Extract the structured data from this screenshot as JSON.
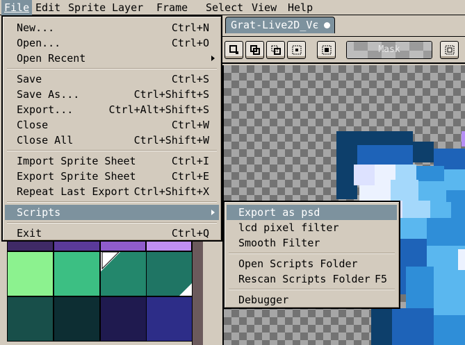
{
  "menubar": {
    "file": "File",
    "edit": "Edit",
    "sprite": "Sprite",
    "layer": "Layer",
    "frame": "Frame",
    "select": "Select",
    "view": "View",
    "help": "Help"
  },
  "tab": {
    "title": "Grat-Live2D_Vє"
  },
  "toolbar": {
    "mask_label": "Mask"
  },
  "file_menu": {
    "items": [
      {
        "label": "New...",
        "shortcut": "Ctrl+N"
      },
      {
        "label": "Open...",
        "shortcut": "Ctrl+O"
      },
      {
        "label": "Open Recent",
        "shortcut": ""
      },
      {
        "label": "Save",
        "shortcut": "Ctrl+S"
      },
      {
        "label": "Save As...",
        "shortcut": "Ctrl+Shift+S"
      },
      {
        "label": "Export...",
        "shortcut": "Ctrl+Alt+Shift+S"
      },
      {
        "label": "Close",
        "shortcut": "Ctrl+W"
      },
      {
        "label": "Close All",
        "shortcut": "Ctrl+Shift+W"
      },
      {
        "label": "Import Sprite Sheet",
        "shortcut": "Ctrl+I"
      },
      {
        "label": "Export Sprite Sheet",
        "shortcut": "Ctrl+E"
      },
      {
        "label": "Repeat Last Export",
        "shortcut": "Ctrl+Shift+X"
      },
      {
        "label": "Scripts",
        "shortcut": ""
      },
      {
        "label": "Exit",
        "shortcut": "Ctrl+Q"
      }
    ]
  },
  "scripts_menu": {
    "items": [
      {
        "label": "Export as psd",
        "shortcut": ""
      },
      {
        "label": "lcd pixel filter",
        "shortcut": ""
      },
      {
        "label": "Smooth Filter",
        "shortcut": ""
      },
      {
        "label": "Open Scripts Folder",
        "shortcut": ""
      },
      {
        "label": "Rescan Scripts Folder",
        "shortcut": "F5"
      },
      {
        "label": "Debugger",
        "shortcut": ""
      }
    ]
  },
  "colors": {
    "ui_bg": "#d3cbbe",
    "highlight": "#7d929e",
    "accent_tab": "#7d929e"
  },
  "palette": {
    "swatches": [
      "#8cf28f",
      "#3cbf83",
      "#23876c",
      "#1f7564",
      "#184f4a",
      "#0d2e33",
      "#1f1a4f",
      "#2d2d88"
    ],
    "top_strip": [
      "#3f2a66",
      "#5a3a99",
      "#8f5ccc",
      "#bf8ff2"
    ]
  },
  "sprite_colors": [
    "#0d3f6b",
    "#1e63b8",
    "#2f8ed8",
    "#5ab7ef",
    "#a4d8fb",
    "#ecf2ff",
    "#dde2ff",
    "#b58ef5"
  ]
}
